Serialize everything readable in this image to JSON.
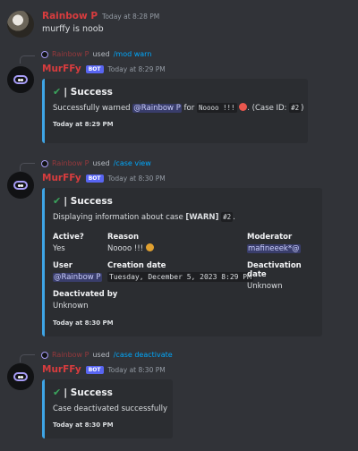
{
  "messages": [
    {
      "author": "Rainbow P",
      "time": "Today at 8:28 PM",
      "text": "murffy is noob"
    },
    {
      "reply": {
        "user": "Rainbow P",
        "used": "used",
        "command": "/mod warn"
      },
      "author": "MurFFy",
      "bot_tag": "BOT",
      "time": "Today at 8:29 PM",
      "embed": {
        "title": "| Success",
        "desc_prefix": "Successfully warned",
        "mention": "@Rainbow P",
        "for_word": "for",
        "reason_code": "Noooo !!!",
        "case_suffix": ". (Case ID:",
        "case_id": "#2",
        "case_close": ")",
        "footer": "Today at 8:29 PM"
      }
    },
    {
      "reply": {
        "user": "Rainbow P",
        "used": "used",
        "command": "/case view"
      },
      "author": "MurFFy",
      "bot_tag": "BOT",
      "time": "Today at 8:30 PM",
      "embed": {
        "title": "| Success",
        "desc_prefix": "Displaying information about case",
        "case_type": "[WARN]",
        "case_id": "#2",
        "desc_suffix": ".",
        "fields": {
          "active_name": "Active?",
          "active_val": "Yes",
          "reason_name": "Reason",
          "reason_val": "Noooo !!!",
          "moderator_name": "Moderator",
          "moderator_val": "mafineeek*@",
          "user_name": "User",
          "user_val": "@Rainbow P",
          "creation_name": "Creation date",
          "creation_val": "Tuesday, December 5, 2023 8:29 PM",
          "deactivation_name": "Deactivation date",
          "deactivation_val": "Unknown",
          "deactivated_by_name": "Deactivated by",
          "deactivated_by_val": "Unknown"
        },
        "footer": "Today at 8:30 PM"
      }
    },
    {
      "reply": {
        "user": "Rainbow P",
        "used": "used",
        "command": "/case deactivate"
      },
      "author": "MurFFy",
      "bot_tag": "BOT",
      "time": "Today at 8:30 PM",
      "embed": {
        "title": "| Success",
        "desc": "Case deactivated successfully",
        "footer": "Today at 8:30 PM"
      }
    }
  ],
  "icons": {
    "check": "✔",
    "bot_avatar": "robot-face-icon"
  },
  "colors": {
    "background": "#313338",
    "embed_bg": "#2b2d31",
    "embed_bar": "#3ea5e6",
    "author_red": "#d83c3e",
    "bot_tag": "#5865f2",
    "command_link": "#00a8fc"
  }
}
